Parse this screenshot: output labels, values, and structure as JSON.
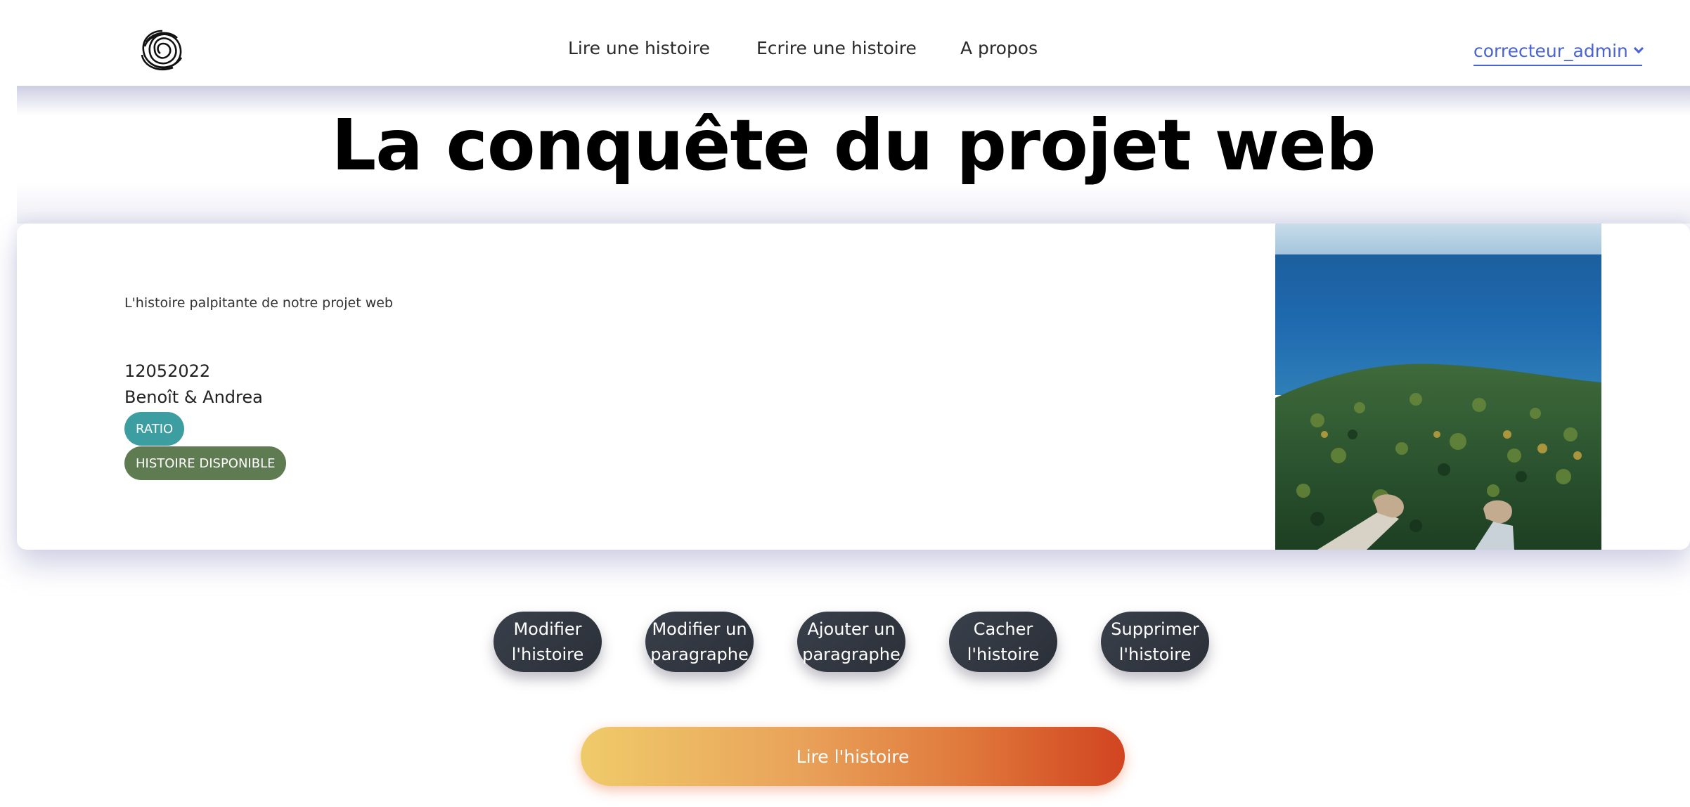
{
  "nav": {
    "logo_name": "swirl-logo",
    "links": [
      "Lire une histoire",
      "Ecrire une histoire",
      "A propos"
    ],
    "user": "correcteur_admin"
  },
  "story": {
    "title": "La conquête du projet web",
    "description": "L'histoire palpitante de notre projet web",
    "date": "12052022",
    "authors": "Benoît & Andrea",
    "badges": [
      "RATIO",
      "HISTOIRE DISPONIBLE"
    ],
    "image_alt": "Vue aérienne d'une forêt au bord de la mer"
  },
  "actions": {
    "edit_story": "Modifier l'histoire",
    "edit_paragraph": "Modifier un paragraphe",
    "add_paragraph": "Ajouter un paragraphe",
    "hide_story": "Cacher l'histoire",
    "delete_story": "Supprimer l'histoire"
  },
  "read_button": "Lire l'histoire",
  "colors": {
    "accent_link": "#4a63d4",
    "badge_ratio": "#3d9ea2",
    "badge_available": "#5e7b52",
    "action_button": "#2f3540",
    "read_gradient_start": "#efcb6a",
    "read_gradient_end": "#d14420"
  }
}
